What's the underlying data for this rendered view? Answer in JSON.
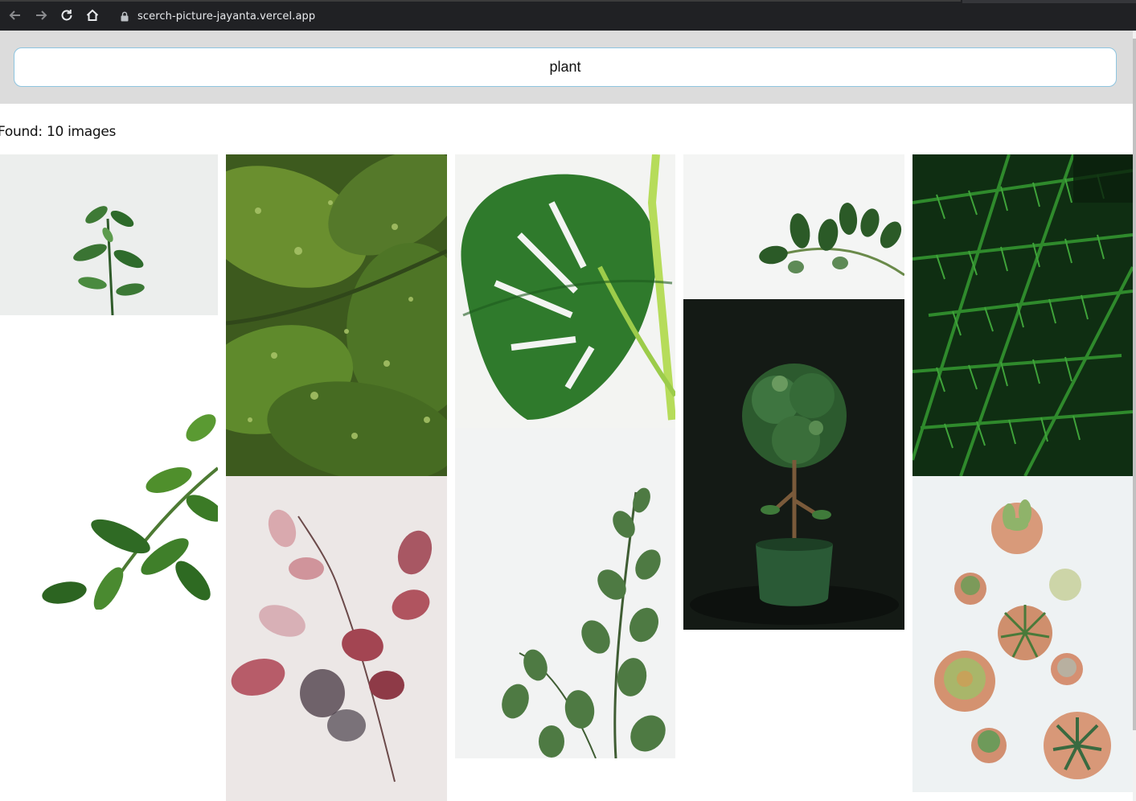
{
  "browser": {
    "url": "scerch-picture-jayanta.vercel.app",
    "back_icon": "arrow-left-icon",
    "forward_icon": "arrow-right-icon",
    "reload_icon": "reload-icon",
    "home_icon": "home-icon",
    "lock_icon": "lock-icon"
  },
  "search": {
    "value": "plant"
  },
  "results": {
    "found_text": "Found: 10 images"
  },
  "images": [
    {
      "subject": "small green plant sprig on white"
    },
    {
      "subject": "green leaves with water drops"
    },
    {
      "subject": "monstera leaf on white"
    },
    {
      "subject": "zz plant branch on white"
    },
    {
      "subject": "fern leaves"
    },
    {
      "subject": "green leafy branches on white"
    },
    {
      "subject": "pink red leaves on light background"
    },
    {
      "subject": "eucalyptus stems on white"
    },
    {
      "subject": "topiary tree in green pot on dark background"
    },
    {
      "subject": "succulents in clay pots top view"
    }
  ],
  "colors": {
    "browser_bar": "#202124",
    "header_bg": "#dcdcdc",
    "input_border": "#8ec5e0"
  }
}
